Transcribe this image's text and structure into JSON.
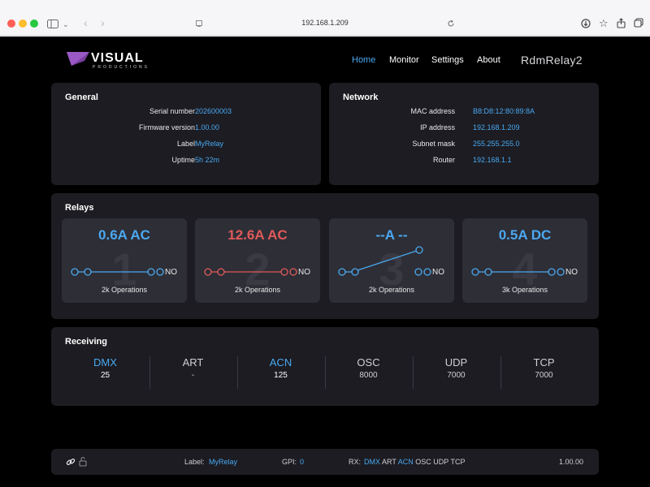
{
  "browser": {
    "url": "192.168.1.209"
  },
  "header": {
    "logo_text": "VISUAL",
    "logo_subtext": "PRODUCTIONS",
    "nav": [
      {
        "label": "Home",
        "active": true
      },
      {
        "label": "Monitor",
        "active": false
      },
      {
        "label": "Settings",
        "active": false
      },
      {
        "label": "About",
        "active": false
      }
    ],
    "product": "RdmRelay2"
  },
  "general": {
    "title": "General",
    "rows": [
      {
        "label": "Serial number",
        "value": "202600003"
      },
      {
        "label": "Firmware version",
        "value": "1.00.00"
      },
      {
        "label": "Label",
        "value": "MyRelay"
      },
      {
        "label": "Uptime",
        "value": "5h 22m"
      }
    ]
  },
  "network": {
    "title": "Network",
    "rows": [
      {
        "label": "MAC address",
        "value": "B8:D8:12:80:89:8A"
      },
      {
        "label": "IP address",
        "value": "192.168.1.209"
      },
      {
        "label": "Subnet mask",
        "value": "255.255.255.0"
      },
      {
        "label": "Router",
        "value": "192.168.1.1"
      }
    ]
  },
  "relays": {
    "title": "Relays",
    "items": [
      {
        "number": "1",
        "current": "0.6A AC",
        "contact": "NO",
        "operations": "2k Operations",
        "color": "#4aa8f0",
        "state": "closed"
      },
      {
        "number": "2",
        "current": "12.6A AC",
        "contact": "NO",
        "operations": "2k Operations",
        "color": "#e05a5a",
        "state": "closed"
      },
      {
        "number": "3",
        "current": "--A --",
        "contact": "NO",
        "operations": "2k Operations",
        "color": "#4aa8f0",
        "state": "open"
      },
      {
        "number": "4",
        "current": "0.5A DC",
        "contact": "NO",
        "operations": "3k Operations",
        "color": "#4aa8f0",
        "state": "closed"
      }
    ]
  },
  "receiving": {
    "title": "Receiving",
    "items": [
      {
        "proto": "DMX",
        "value": "25",
        "active": true
      },
      {
        "proto": "ART",
        "value": "-",
        "active": false
      },
      {
        "proto": "ACN",
        "value": "125",
        "active": true
      },
      {
        "proto": "OSC",
        "value": "8000",
        "active": false
      },
      {
        "proto": "UDP",
        "value": "7000",
        "active": false
      },
      {
        "proto": "TCP",
        "value": "7000",
        "active": false
      }
    ]
  },
  "statusbar": {
    "label_caption": "Label:",
    "label_value": "MyRelay",
    "gpi_caption": "GPI:",
    "gpi_value": "0",
    "rx_caption": "RX:",
    "rx_items": [
      {
        "proto": "DMX",
        "active": true
      },
      {
        "proto": "ART",
        "active": false
      },
      {
        "proto": "ACN",
        "active": true
      },
      {
        "proto": "OSC",
        "active": false
      },
      {
        "proto": "UDP",
        "active": false
      },
      {
        "proto": "TCP",
        "active": false
      }
    ],
    "version": "1.00.00"
  },
  "colors": {
    "accent": "#4aa8f0",
    "alarm": "#e05a5a",
    "card": "#1c1c22",
    "relay_card": "#2e2e36"
  }
}
